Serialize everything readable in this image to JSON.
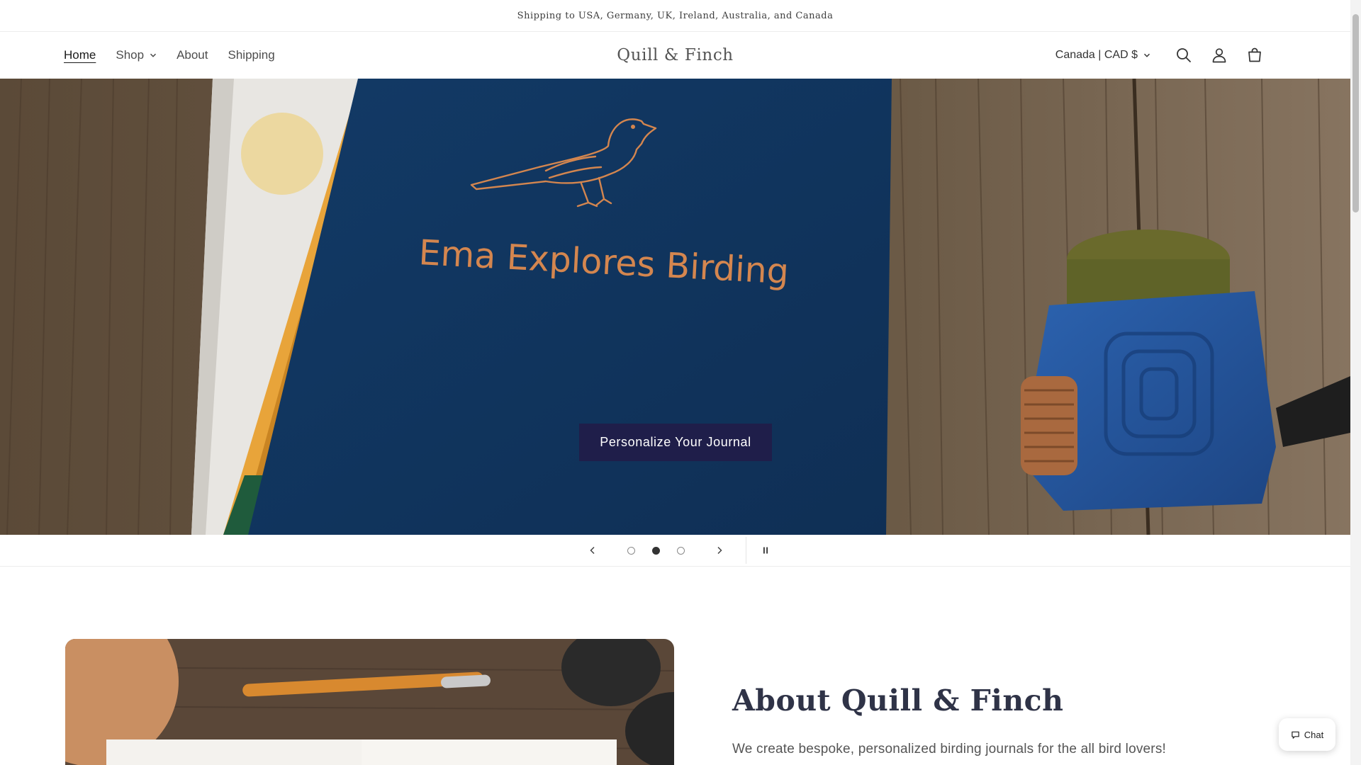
{
  "announcement": {
    "text": "Shipping to USA, Germany, UK, Ireland, Australia, and Canada"
  },
  "header": {
    "nav": [
      {
        "label": "Home",
        "active": true
      },
      {
        "label": "Shop",
        "has_dropdown": true
      },
      {
        "label": "About"
      },
      {
        "label": "Shipping"
      }
    ],
    "logo": "Quill & Finch",
    "currency": "Canada | CAD $",
    "icons": [
      "search-icon",
      "account-icon",
      "cart-icon"
    ]
  },
  "hero": {
    "journal_title": "Ema Explores Birding",
    "cta_label": "Personalize Your Journal",
    "slides_total": 3,
    "active_slide": 2
  },
  "slider_controls": {
    "icons": [
      "chevron-left-icon",
      "chevron-right-icon",
      "pause-icon"
    ]
  },
  "about": {
    "title": "About Quill & Finch",
    "body": "We create bespoke, personalized birding journals for the all bird lovers!"
  },
  "chat": {
    "label": "Chat"
  },
  "colors": {
    "cta_bg": "#1f1e4a",
    "journal_blue": "#163b66",
    "copper": "#d4864f",
    "wood": "#6e5a45"
  }
}
